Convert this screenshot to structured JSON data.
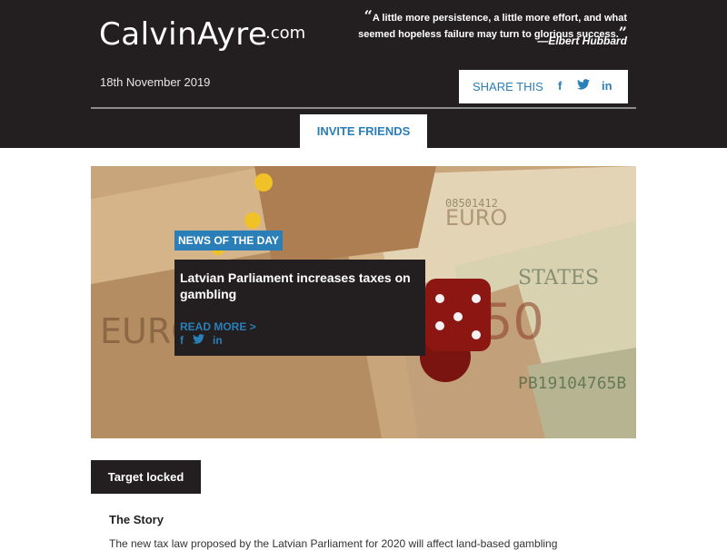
{
  "header": {
    "logo_main": "CalvinAyre",
    "logo_suffix": ".com",
    "quote_text": "A little more persistence, a little more effort, and what seemed hopeless failure may turn to glorious success.",
    "quote_author": "—Elbert Hubbard",
    "date": "18th November 2019",
    "share_label": "SHARE THIS",
    "invite_label": "INVITE FRIENDS"
  },
  "hero": {
    "badge": "NEWS OF THE DAY",
    "title": "Latvian Parliament increases taxes on gambling",
    "read_more": "READ MORE >"
  },
  "story": {
    "section_label": "Target locked",
    "heading": "The Story",
    "text": "The new tax law proposed by the Latvian Parliament for 2020 will affect land-based gambling"
  },
  "colors": {
    "dark": "#231f20",
    "accent": "#2a7fb8",
    "white": "#ffffff"
  },
  "icons": [
    "facebook-icon",
    "twitter-icon",
    "linkedin-icon",
    "euro-banknote-image",
    "dice-image"
  ]
}
